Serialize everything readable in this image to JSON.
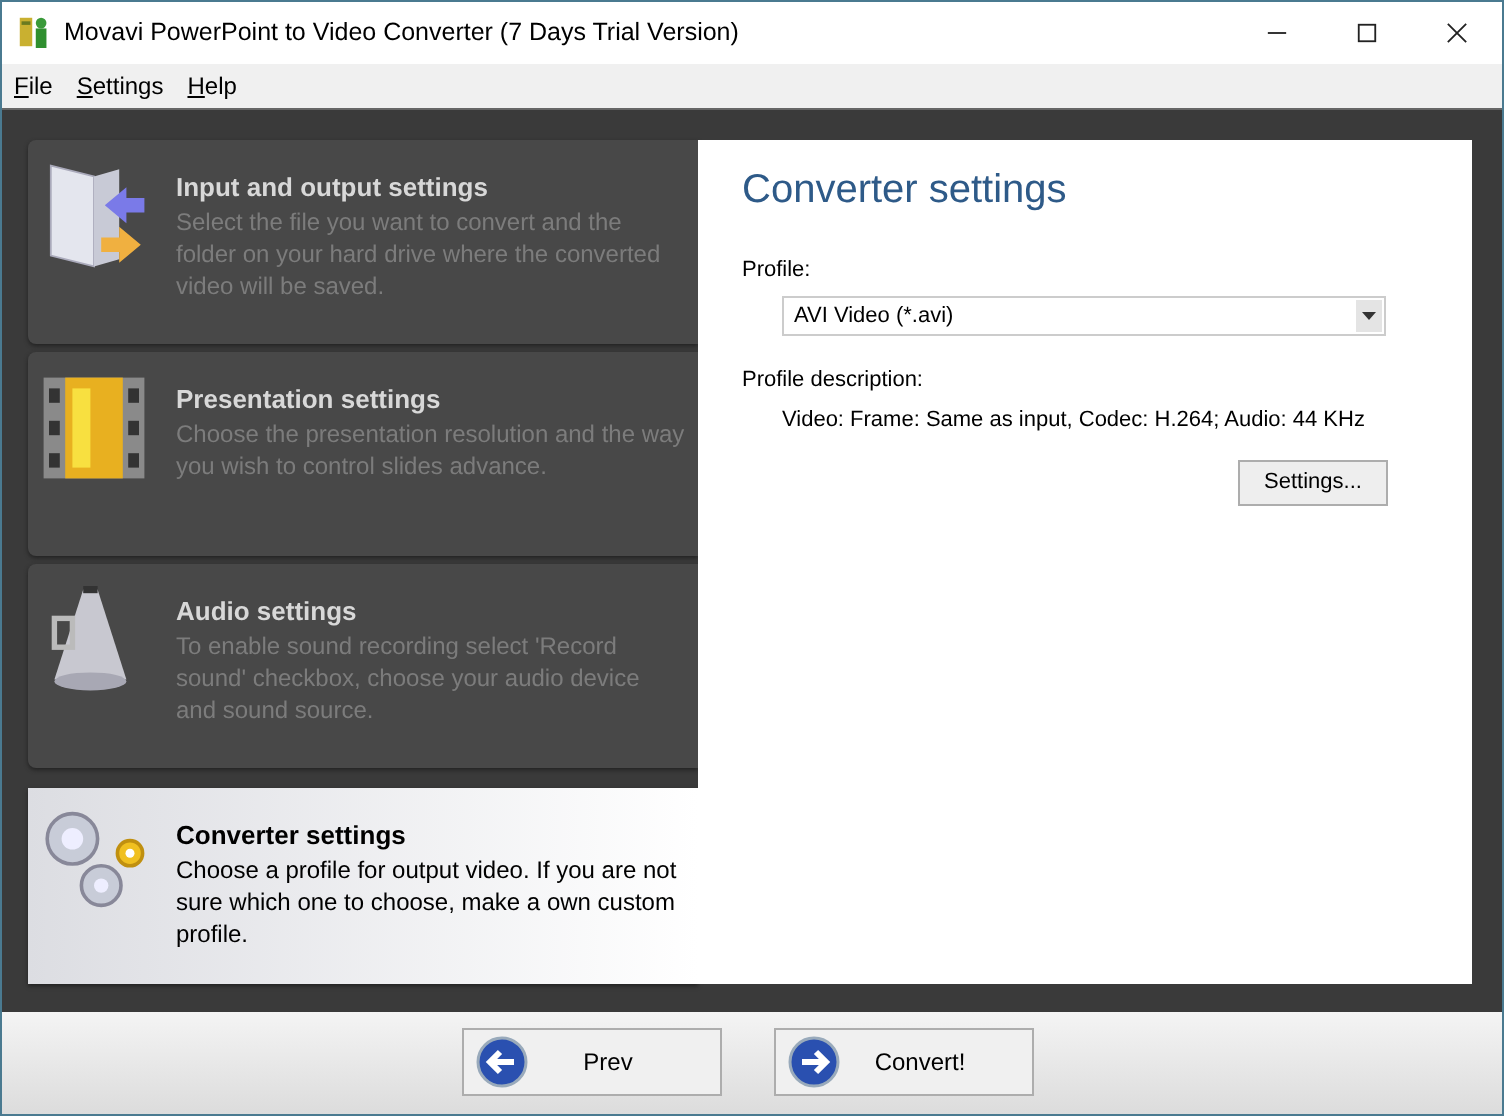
{
  "window": {
    "title": "Movavi PowerPoint to Video Converter (7 Days Trial Version)"
  },
  "menu": [
    "File",
    "Settings",
    "Help"
  ],
  "steps": [
    {
      "title": "Input and output settings",
      "description": "Select the file you want to convert and the folder on your hard drive where the converted video will be saved.",
      "selected": false
    },
    {
      "title": "Presentation settings",
      "description": "Choose the presentation resolution and the way you wish to control slides advance.",
      "selected": false
    },
    {
      "title": "Audio settings",
      "description": "To enable sound recording select 'Record sound' checkbox, choose your audio device and sound source.",
      "selected": false
    },
    {
      "title": "Converter settings",
      "description": "Choose a profile for output video. If you are not sure which one to choose, make a own custom profile.",
      "selected": true
    }
  ],
  "panel": {
    "heading": "Converter settings",
    "profile_label": "Profile:",
    "profile_value": "AVI Video (*.avi)",
    "description_label": "Profile description:",
    "description": "Video: Frame: Same as input, Codec: H.264; Audio: 44 KHz",
    "settings_button": "Settings..."
  },
  "buttons": [
    {
      "label": "Prev",
      "kind": "back"
    },
    {
      "label": "Convert!",
      "kind": "forward"
    }
  ]
}
